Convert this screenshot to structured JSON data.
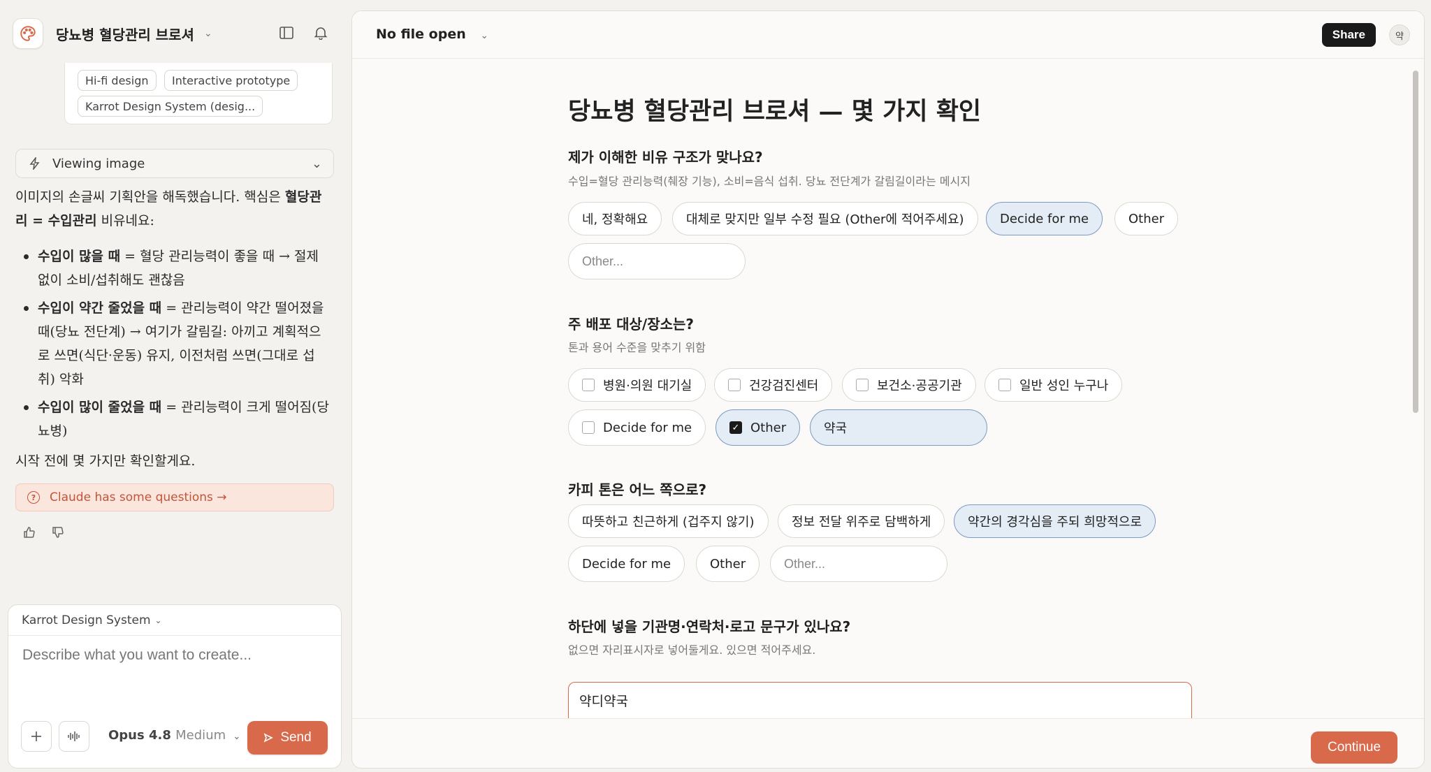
{
  "sidebar": {
    "project_title": "당뇨병 혈당관리 브로셔",
    "tags": [
      "Hi-fi design",
      "Interactive prototype",
      "Karrot Design System (desig..."
    ],
    "viewing_label": "Viewing image",
    "message": {
      "intro_1": "이미지의 손글씨 기획안을 해독했습니다. 핵심은",
      "intro_bold": "혈당관리 = 수입관리",
      "intro_2": " 비유네요:",
      "bullets": [
        {
          "bold": "수입이 많을 때",
          "text": " = 혈당 관리능력이 좋을 때 → 절제 없이 소비/섭취해도 괜찮음"
        },
        {
          "bold": "수입이 약간 줄었을 때",
          "text": " = 관리능력이 약간 떨어졌을 때(당뇨 전단계) → 여기가 갈림길: 아끼고 계획적으로 쓰면(식단·운동) 유지, 이전처럼 쓰면(그대로 섭취) 악화"
        },
        {
          "bold": "수입이 많이 줄었을 때",
          "text": " = 관리능력이 크게 떨어짐(당뇨병)"
        }
      ],
      "outro": "시작 전에 몇 가지만 확인할게요."
    },
    "questions_label": "Claude has some questions →",
    "composer": {
      "design_system": "Karrot Design System",
      "placeholder": "Describe what you want to create...",
      "model": "Opus 4.8",
      "effort": "Medium",
      "send_label": "Send"
    }
  },
  "header": {
    "file_label": "No file open",
    "share_label": "Share",
    "avatar_initial": "약"
  },
  "form": {
    "title": "당뇨병 혈당관리 브로셔 — 몇 가지 확인",
    "q1": {
      "title": "제가 이해한 비유 구조가 맞나요?",
      "subtitle": "수입=혈당 관리능력(췌장 기능), 소비=음식 섭취. 당뇨 전단계가 갈림길이라는 메시지",
      "options": [
        "네, 정확해요",
        "대체로 맞지만 일부 수정 필요 (Other에 적어주세요)",
        "Decide for me",
        "Other"
      ],
      "selected": "Decide for me",
      "other_placeholder": "Other..."
    },
    "q2": {
      "title": "주 배포 대상/장소는?",
      "subtitle": "톤과 용어 수준을 맞추기 위함",
      "options": [
        "병원·의원 대기실",
        "건강검진센터",
        "보건소·공공기관",
        "일반 성인 누구나",
        "Decide for me",
        "Other"
      ],
      "checked": [
        "Other"
      ],
      "other_value": "약국"
    },
    "q3": {
      "title": "카피 톤은 어느 쪽으로?",
      "options": [
        "따뜻하고 친근하게 (겁주지 않기)",
        "정보 전달 위주로 담백하게",
        "약간의 경각심을 주되 희망적으로",
        "Decide for me",
        "Other"
      ],
      "selected": "약간의 경각심을 주되 희망적으로",
      "other_placeholder": "Other..."
    },
    "q4": {
      "title": "하단에 넣을 기관명·연락처·로고 문구가 있나요?",
      "subtitle": "없으면 자리표시자로 넣어둘게요. 있으면 적어주세요.",
      "value": "약디약국"
    }
  },
  "footer": {
    "continue_label": "Continue"
  },
  "colors": {
    "accent": "#d9694b",
    "selected_bg": "#e4ecf5",
    "selected_border": "#7a9ac4"
  }
}
